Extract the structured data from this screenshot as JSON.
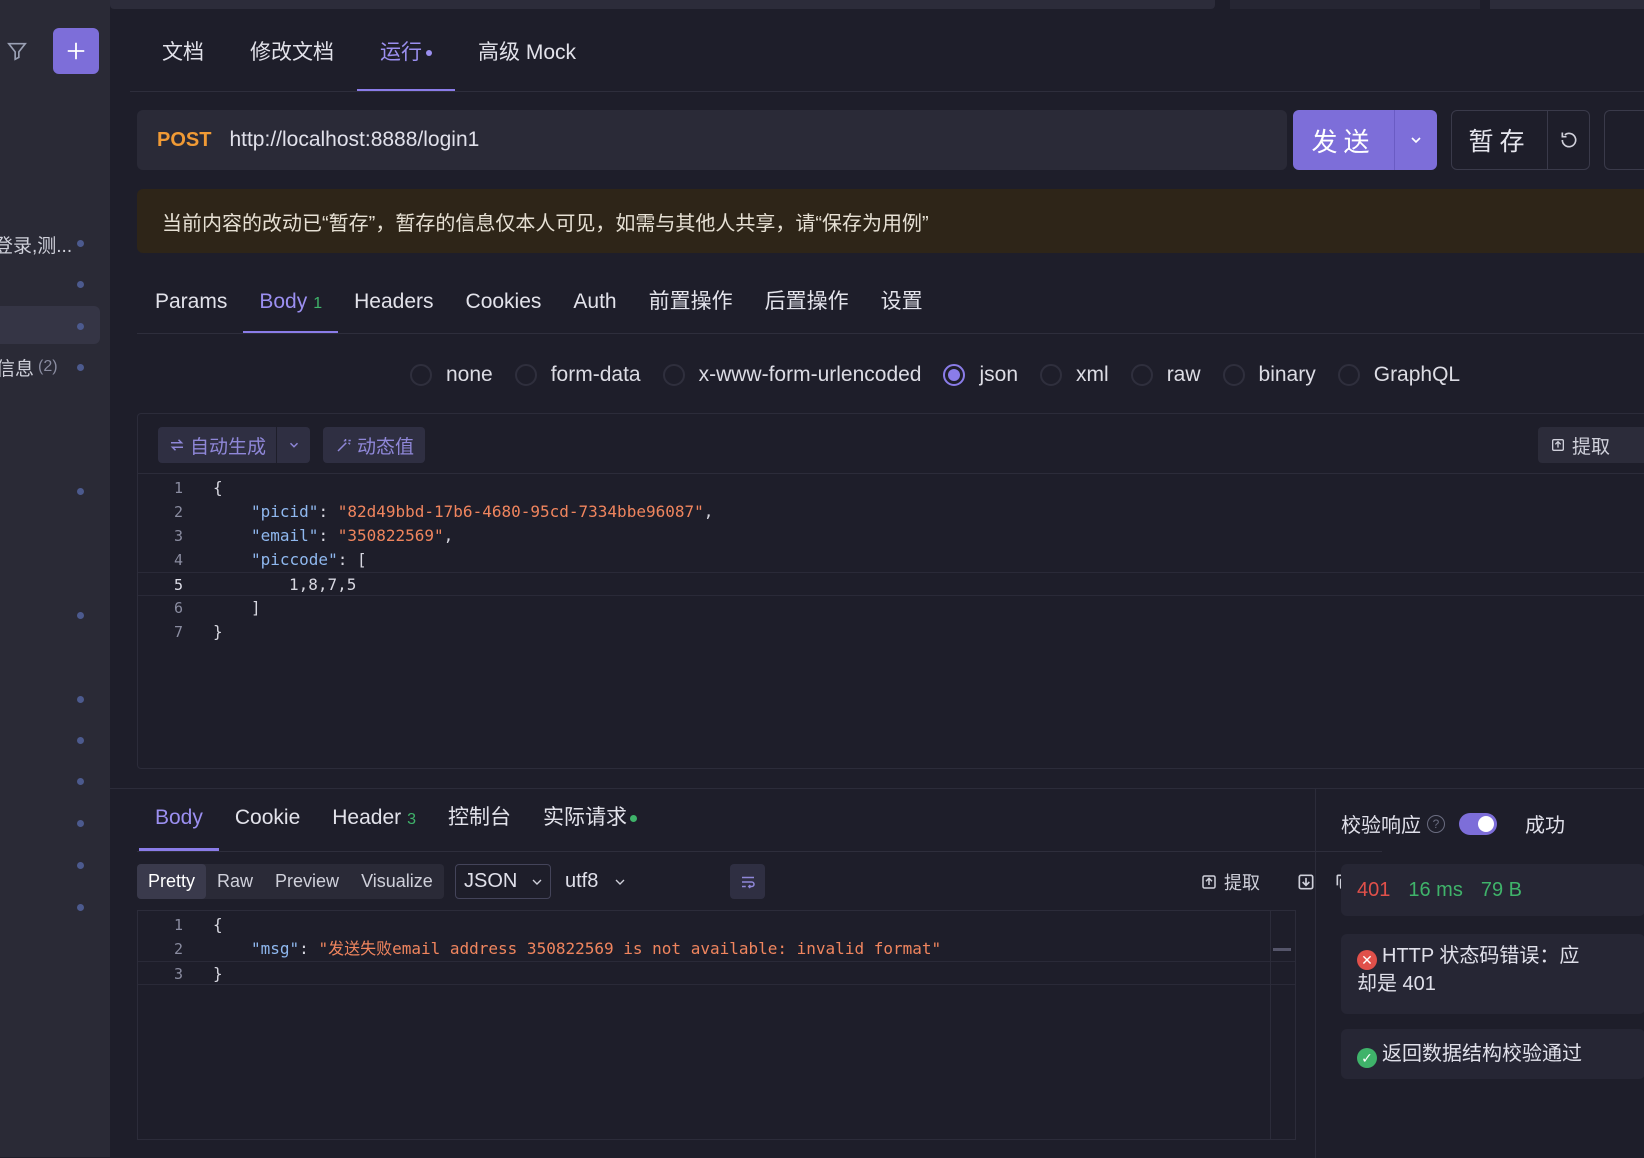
{
  "sidebar": {
    "items": [
      {
        "label": "登录,测..."
      },
      {
        "label": ""
      },
      {
        "label": ""
      },
      {
        "label": "信息",
        "count": "(2)"
      }
    ]
  },
  "doc_tabs": [
    {
      "label": "文档"
    },
    {
      "label": "修改文档"
    },
    {
      "label": "运行"
    },
    {
      "label": "高级 Mock"
    }
  ],
  "request": {
    "method": "POST",
    "url": "http://localhost:8888/login1",
    "send_label": "发送",
    "save_label": "暂存"
  },
  "notice": "当前内容的改动已“暂存”，暂存的信息仅本人可见，如需与其他人共享，请“保存为用例”",
  "req_tabs": [
    {
      "label": "Params"
    },
    {
      "label": "Body",
      "badge": "1"
    },
    {
      "label": "Headers"
    },
    {
      "label": "Cookies"
    },
    {
      "label": "Auth"
    },
    {
      "label": "前置操作"
    },
    {
      "label": "后置操作"
    },
    {
      "label": "设置"
    }
  ],
  "body_types": [
    "none",
    "form-data",
    "x-www-form-urlencoded",
    "json",
    "xml",
    "raw",
    "binary",
    "GraphQL"
  ],
  "body_type_selected": "json",
  "editor_toolbar": {
    "auto_gen": "自动生成",
    "dynamic": "动态值",
    "extract": "提取"
  },
  "request_body_lines": [
    {
      "n": "1",
      "text": "{"
    },
    {
      "n": "2",
      "key": "\"picid\"",
      "sep": ": ",
      "value": "\"82d49bbd-17b6-4680-95cd-7334bbe96087\"",
      "tail": ","
    },
    {
      "n": "3",
      "key": "\"email\"",
      "sep": ": ",
      "value": "\"350822569\"",
      "tail": ","
    },
    {
      "n": "4",
      "key": "\"piccode\"",
      "sep": ": ",
      "value": "",
      "tail": "["
    },
    {
      "n": "5",
      "text": "1,8,7,5"
    },
    {
      "n": "6",
      "text": "]"
    },
    {
      "n": "7",
      "text": "}"
    }
  ],
  "resp_tabs": [
    {
      "label": "Body"
    },
    {
      "label": "Cookie"
    },
    {
      "label": "Header",
      "badge": "3"
    },
    {
      "label": "控制台"
    },
    {
      "label": "实际请求"
    }
  ],
  "view_modes": [
    "Pretty",
    "Raw",
    "Preview",
    "Visualize"
  ],
  "view_mode_selected": "Pretty",
  "format": "JSON",
  "encoding": "utf8",
  "resp_tools": {
    "extract": "提取"
  },
  "response_body_lines": [
    {
      "n": "1",
      "text": "{"
    },
    {
      "n": "2",
      "key": "\"msg\"",
      "sep": ": ",
      "value": "\"发送失败email address 350822569 is not available: invalid format\""
    },
    {
      "n": "3",
      "text": "}"
    }
  ],
  "validation": {
    "label": "校验响应",
    "help": "?",
    "success_label": "成功",
    "status_code": "401",
    "time": "16 ms",
    "size": "79 B",
    "error_line1": "HTTP 状态码错误：应",
    "error_line2": "却是 401",
    "ok_msg": "返回数据结构校验通过"
  },
  "colors": {
    "accent": "#7d6ed9",
    "method": "#f09a35",
    "error": "#e0504a",
    "success": "#3fb36a"
  }
}
